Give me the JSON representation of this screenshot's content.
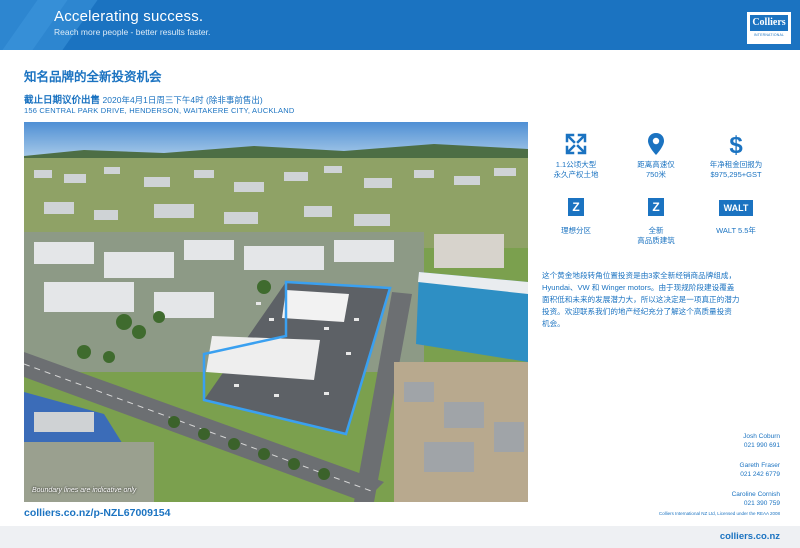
{
  "header": {
    "title": "Accelerating success.",
    "subtitle": "Reach more people - better results faster.",
    "logo": {
      "name": "Colliers",
      "tagline": "INTERNATIONAL"
    },
    "color": "#1b73c1"
  },
  "listing": {
    "heading": "知名品牌的全新投资机会",
    "sale_method": "截止日期议价出售",
    "deadline": "2020年4月1日周三下午4时 (除非事前售出)",
    "address": "156 CENTRAL PARK DRIVE, HENDERSON, WAITAKERE CITY, AUCKLAND",
    "photo_note": "Boundary lines are indicative only"
  },
  "features": [
    {
      "icon": "expand-arrows-icon",
      "line1": "1.1公顷大型",
      "line2": "永久产权土地"
    },
    {
      "icon": "location-pin-icon",
      "line1": "距离高速仅",
      "line2": "750米"
    },
    {
      "icon": "dollar-icon",
      "line1": "年净租金回报为",
      "line2": "$975,295+GST"
    },
    {
      "icon": "zone-z-icon",
      "badge": "Z",
      "line1": "理想分区",
      "line2": ""
    },
    {
      "icon": "zone-z-icon",
      "badge": "Z",
      "line1": "全新",
      "line2": "高品质建筑"
    },
    {
      "icon": "walt-badge-icon",
      "badge": "WALT",
      "line1": "WALT 5.5年",
      "line2": ""
    }
  ],
  "description": [
    "这个黄金地段转角位置投资是由3家全新经销商品牌组成，",
    "Hyundai、VW 和 Winger motors。由于现规阶段建设覆盖",
    "面积低和未来的发展潜力大，所以这决定是一项真正的潜力",
    "投资。欢迎联系我们的地产经纪充分了解这个高质量投资",
    "机会。"
  ],
  "contacts": [
    {
      "name": "Josh Coburn",
      "phone": "021 990 691"
    },
    {
      "name": "Gareth Fraser",
      "phone": "021 242 6779"
    },
    {
      "name": "Caroline Cornish",
      "phone": "021 390 759"
    }
  ],
  "footer": {
    "listing_link": "colliers.co.nz/p-NZL67009154",
    "license": "Colliers International NZ Ltd, Licensed under the REAA 2008",
    "site": "colliers.co.nz"
  }
}
